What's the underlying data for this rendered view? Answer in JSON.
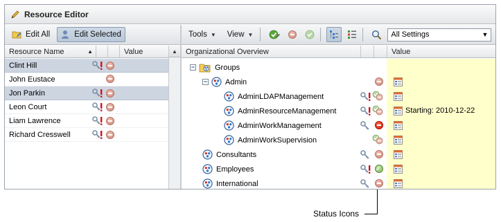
{
  "title": "Resource Editor",
  "left_toolbar": {
    "edit_all": "Edit All",
    "edit_selected": "Edit Selected"
  },
  "left_columns": {
    "name": "Resource Name",
    "value": "Value"
  },
  "resources": [
    {
      "name": "Clint Hill",
      "selected": true,
      "icons": [
        "key-alert-icon",
        "stop-icon"
      ]
    },
    {
      "name": "John Eustace",
      "selected": false,
      "icons": [
        "stop-icon"
      ]
    },
    {
      "name": "Jon Parkin",
      "selected": true,
      "icons": [
        "key-alert-icon",
        "stop-icon"
      ]
    },
    {
      "name": "Leon Court",
      "selected": false,
      "icons": [
        "key-alert-icon",
        "stop-icon"
      ]
    },
    {
      "name": "Liam Lawrence",
      "selected": false,
      "icons": [
        "key-alert-icon",
        "stop-icon"
      ]
    },
    {
      "name": "Richard Cresswell",
      "selected": false,
      "icons": [
        "key-alert-icon",
        "stop-icon"
      ]
    }
  ],
  "right_toolbar": {
    "tools": "Tools",
    "view": "View",
    "filter_value": "All Settings"
  },
  "right_columns": {
    "overview": "Organizational Overview",
    "value": "Value"
  },
  "tree": [
    {
      "label": "Groups",
      "level": 0,
      "expander": "−",
      "kind": "folder"
    },
    {
      "label": "Admin",
      "level": 1,
      "expander": "−",
      "kind": "group",
      "icons": [
        "stop-icon"
      ]
    },
    {
      "label": "AdminLDAPManagement",
      "level": 2,
      "kind": "group",
      "icons": [
        "key-alert-icon",
        "check-stop-icon"
      ]
    },
    {
      "label": "AdminResourceManagement",
      "level": 2,
      "kind": "group",
      "icons": [
        "key-alert-icon",
        "check-stop-icon"
      ],
      "value": "Starting: 2010-12-22"
    },
    {
      "label": "AdminWorkManagement",
      "level": 2,
      "kind": "group",
      "icons": [
        "key-icon",
        "stop-red-icon"
      ]
    },
    {
      "label": "AdminWorkSupervision",
      "level": 2,
      "kind": "group",
      "icons": [
        "check-stop-icon"
      ]
    },
    {
      "label": "Consultants",
      "level": 1,
      "kind": "group",
      "icons": [
        "key-icon",
        "stop-icon"
      ]
    },
    {
      "label": "Employees",
      "level": 1,
      "kind": "group",
      "icons": [
        "key-alert-icon",
        "check-icon"
      ]
    },
    {
      "label": "International",
      "level": 1,
      "kind": "group",
      "icons": [
        "key-icon",
        "stop-icon"
      ]
    }
  ],
  "callout": "Status Icons"
}
